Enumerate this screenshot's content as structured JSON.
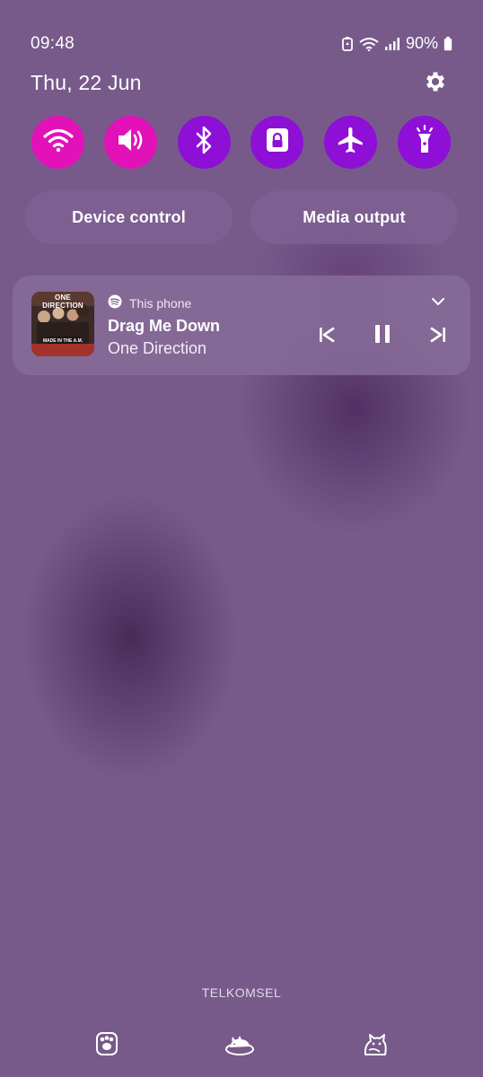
{
  "status_bar": {
    "time": "09:48",
    "battery_percent": "90%"
  },
  "header": {
    "date": "Thu, 22 Jun"
  },
  "quick_toggles": [
    {
      "icon": "wifi-icon",
      "state": "on",
      "color": "#e311b8"
    },
    {
      "icon": "volume-icon",
      "state": "on",
      "color": "#e311b8"
    },
    {
      "icon": "bluetooth-icon",
      "state": "on",
      "color": "#8e0fd6"
    },
    {
      "icon": "lock-icon",
      "state": "on",
      "color": "#8e0fd6"
    },
    {
      "icon": "airplane-icon",
      "state": "on",
      "color": "#8e0fd6"
    },
    {
      "icon": "flashlight-icon",
      "state": "on",
      "color": "#8e0fd6"
    }
  ],
  "pills": {
    "device_control": "Device control",
    "media_output": "Media output"
  },
  "media": {
    "source": "This phone",
    "title": "Drag Me Down",
    "artist": "One Direction",
    "album_art_text": "ONE DIRECTION",
    "album_art_subtext": "MADE IN THE A.M."
  },
  "carrier": "TELKOMSEL",
  "bottom_icons": [
    "paw-icon",
    "sleeping-cat-icon",
    "cat-icon"
  ]
}
